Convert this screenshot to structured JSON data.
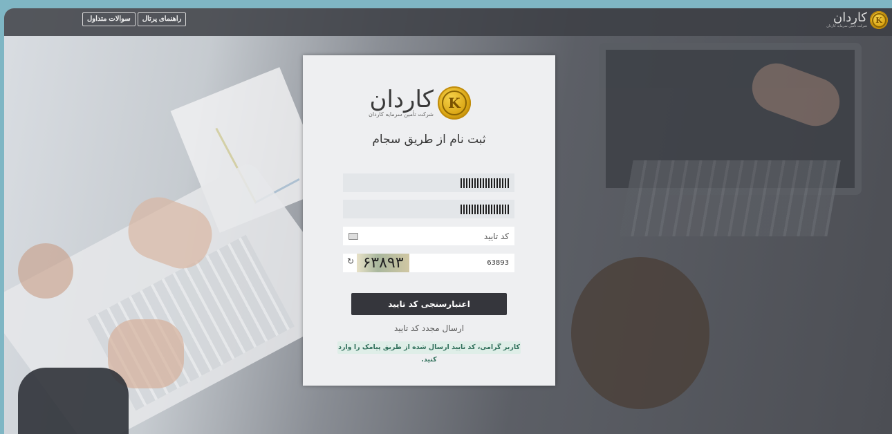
{
  "topbar": {
    "buttons": [
      {
        "label": "سوالات متداول"
      },
      {
        "label": "راهنمای پرتال"
      }
    ],
    "brand_name": "کاردان",
    "brand_sub": "شرکت تامین سرمایه کاردان"
  },
  "card": {
    "logo_text": "کاردان",
    "logo_sub": "شرکت تأمین سرمایه کاردان",
    "title": "ثبت نام از طریق سجام",
    "field1_value": "",
    "field2_value": "",
    "otp_placeholder": "کد تایید",
    "captcha_value": "63893",
    "captcha_image_text": "۶۳۸۹۳",
    "verify_button": "اعتبارسنجی کد تایید",
    "resend_link": "ارسال مجدد کد تایید",
    "hint": "کاربر گرامی، کد تایید ارسال شده از طریق پیامک را وارد کنید."
  },
  "icons": {
    "logo": "k-coin-icon",
    "keyboard": "keyboard-icon",
    "refresh": "refresh-icon"
  },
  "colors": {
    "button_bg": "#35363c",
    "hint_bg": "#dfeee8",
    "hint_text": "#2f6f5a",
    "coin_gold": "#d9a412"
  }
}
